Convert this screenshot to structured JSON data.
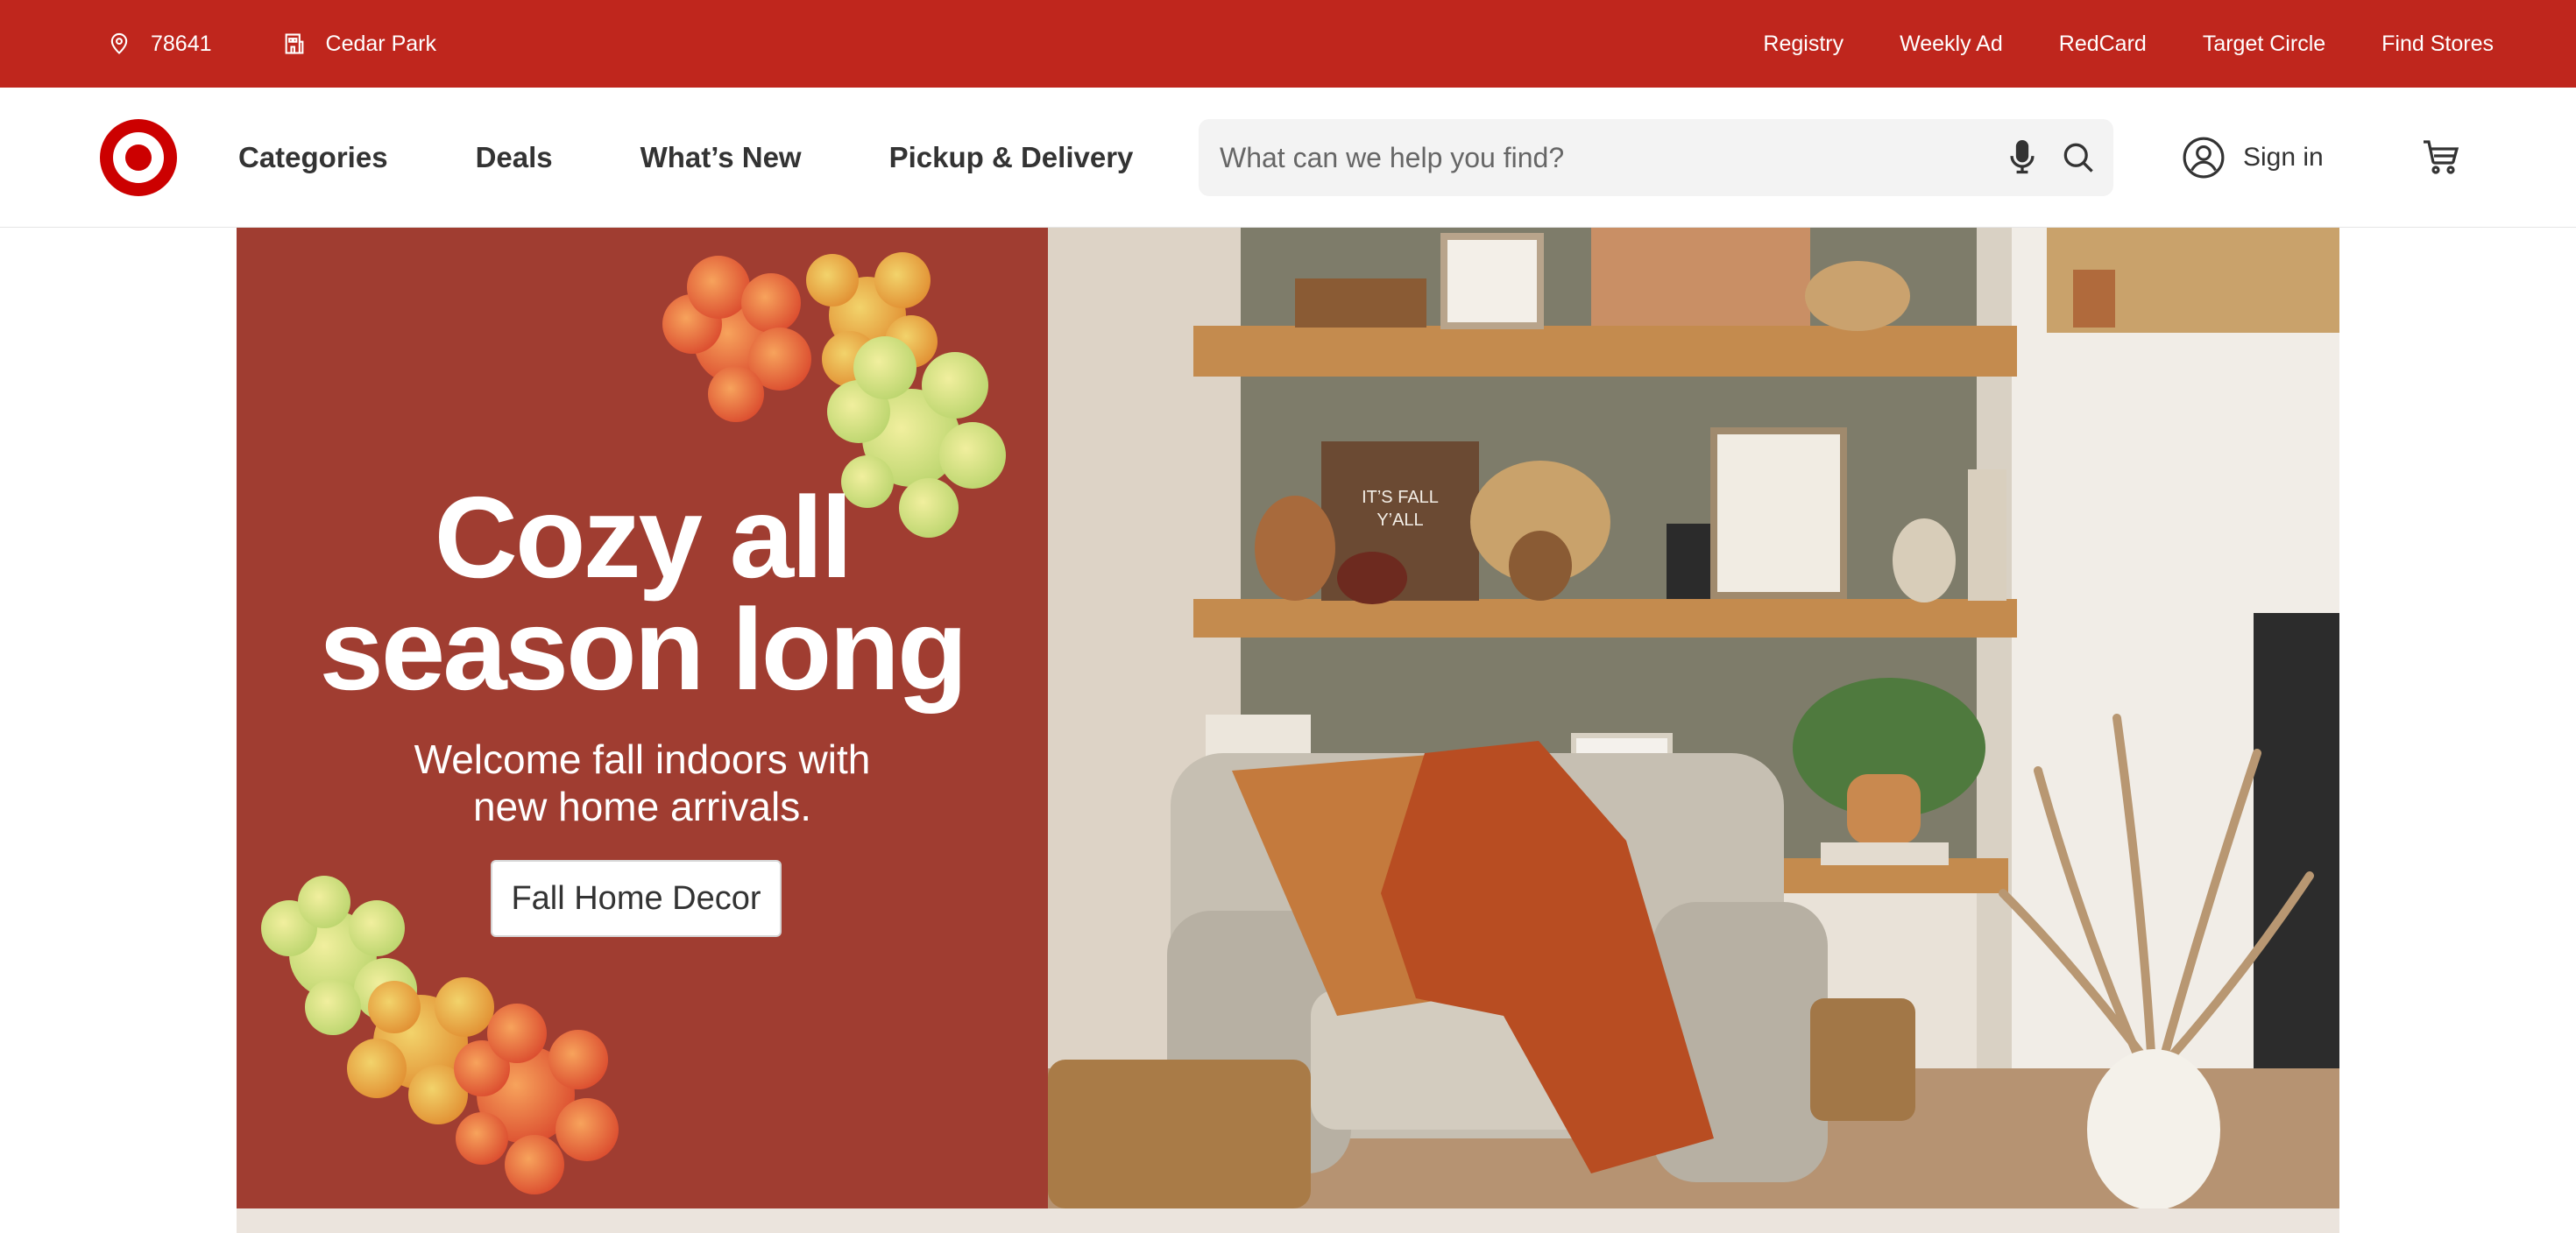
{
  "colors": {
    "brand_red": "#cc0000",
    "utility_bar": "#bf261d",
    "promo_panel": "#a03d31"
  },
  "utility_bar": {
    "zip": "78641",
    "store": "Cedar Park",
    "links": [
      "Registry",
      "Weekly Ad",
      "RedCard",
      "Target Circle",
      "Find Stores"
    ]
  },
  "header": {
    "logo": "target-bullseye-logo",
    "nav": [
      "Categories",
      "Deals",
      "What’s New",
      "Pickup & Delivery"
    ],
    "search": {
      "placeholder": "What can we help you find?",
      "value": ""
    },
    "signin_label": "Sign in",
    "icons": [
      "map-pin-icon",
      "store-icon",
      "microphone-icon",
      "search-icon",
      "account-icon",
      "cart-icon"
    ]
  },
  "hero": {
    "headline": [
      "Cozy all",
      "season long"
    ],
    "subtext": [
      "Welcome fall indoors with",
      "new home arrivals."
    ],
    "cta_label": "Fall Home Decor",
    "image_description": "living room with wooden shelves, fall decor, armchair and orange throw",
    "shelf_sign": "IT’S FALL Y’ALL"
  }
}
